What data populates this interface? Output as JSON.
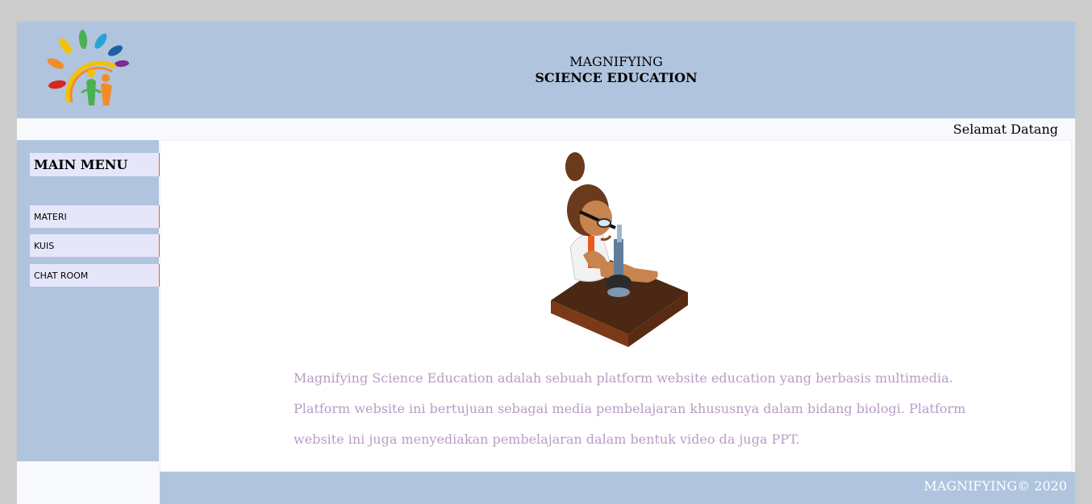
{
  "header": {
    "title_line1": "MAGNIFYING",
    "title_line2": "SCIENCE EDUCATION",
    "logo_icon": "colorful-sun-family-logo-icon"
  },
  "welcome_text": "Selamat Datang",
  "sidebar": {
    "heading": "MAIN MENU",
    "items": [
      {
        "label": "MATERI"
      },
      {
        "label": "KUIS"
      },
      {
        "label": "CHAT ROOM"
      }
    ]
  },
  "main": {
    "illustration_icon": "scientist-microscope-illustration",
    "description": "Magnifying Science Education adalah sebuah platform website education yang berbasis multimedia. Platform website ini bertujuan sebagai media pembelajaran khususnya dalam bidang biologi. Platform website ini juga menyediakan pembelajaran dalam bentuk video da juga PPT."
  },
  "footer": {
    "text": "MAGNIFYING© 2020"
  },
  "colors": {
    "header_bg": "#b0c4de",
    "menu_item_bg": "#e6e6fa",
    "accent_tab": "#ff6600",
    "description_text": "#b89cc4"
  }
}
